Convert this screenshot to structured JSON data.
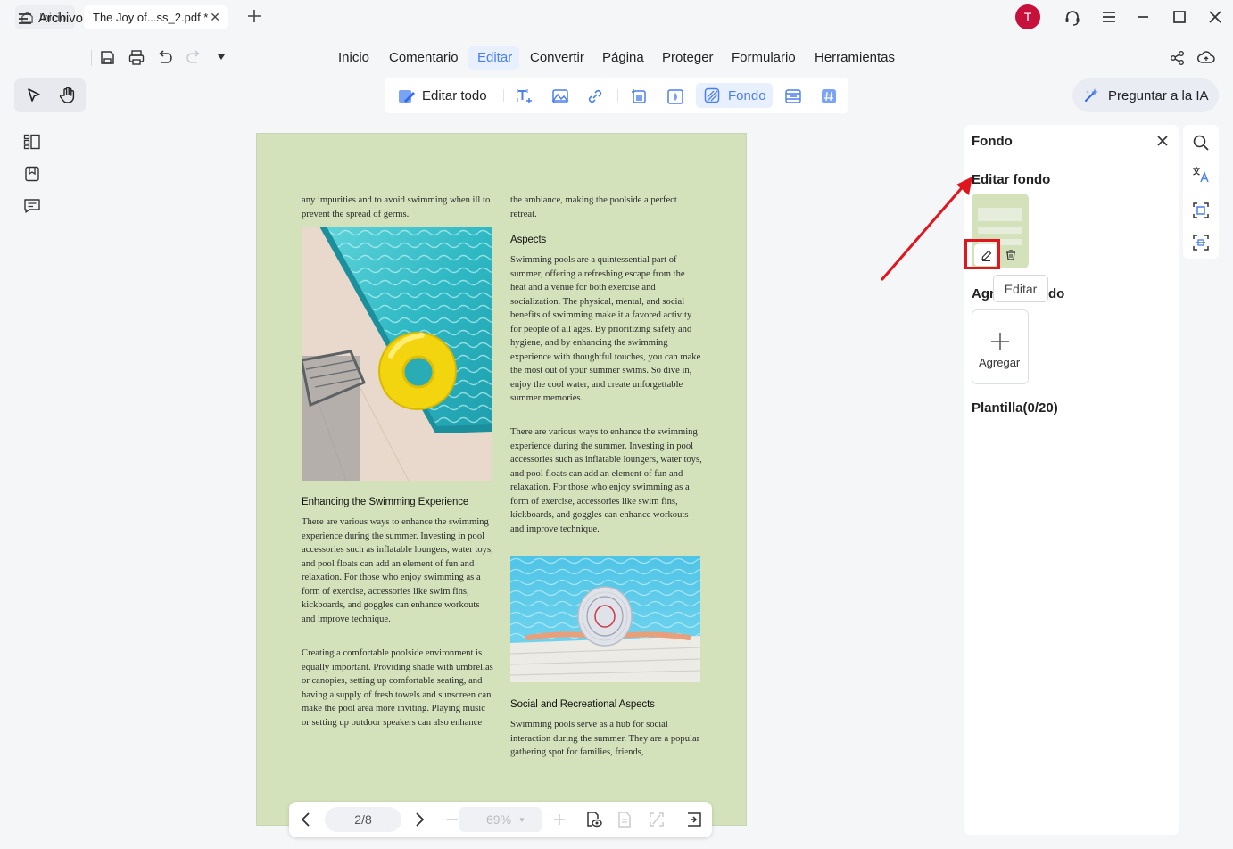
{
  "tabs": {
    "home_label": "Inicio",
    "doc_label": "The Joy of...ss_2.pdf *",
    "close_glyph": "✕",
    "new_tab_icon": "plus-icon"
  },
  "user": {
    "avatar_letter": "T",
    "avatar_color": "#c8103c"
  },
  "menu": {
    "file_label": "Archivo",
    "items": [
      "Inicio",
      "Comentario",
      "Editar",
      "Convertir",
      "Página",
      "Proteger",
      "Formulario",
      "Herramientas"
    ],
    "active": "Editar"
  },
  "toolbar": {
    "edit_all": "Editar todo",
    "background": "Fondo"
  },
  "ai": {
    "label": "Preguntar a la IA"
  },
  "document": {
    "col1_para1": "any impurities and to avoid swimming when ill to prevent the spread of germs.",
    "col1_heading": "Enhancing the Swimming Experience",
    "col1_para2": "There are various ways to enhance the swimming experience during the summer. Investing in pool accessories such as inflatable loungers, water toys, and pool floats can add an element of fun and relaxation. For those who enjoy swimming as a form of exercise, accessories like swim fins, kickboards, and goggles can enhance workouts and improve technique.",
    "col1_para3": "Creating a comfortable poolside environment is equally important. Providing shade with umbrellas or canopies, setting up comfortable seating, and having a supply of fresh towels and sunscreen can make the pool area more inviting. Playing music or setting up outdoor speakers can also enhance",
    "col2_para1": "the ambiance, making the poolside a perfect retreat.",
    "col2_heading1": "Aspects",
    "col2_para2": "Swimming pools are a quintessential part of summer, offering a refreshing escape from the heat and a venue for both exercise and socialization. The physical, mental, and social benefits of swimming make it a favored activity for people of all ages. By prioritizing safety and hygiene, and by enhancing the swimming experience with thoughtful touches, you can make the most out of your summer swims. So dive in, enjoy the cool water, and create unforgettable summer memories.",
    "col2_para3": "There are various ways to enhance the swimming experience during the summer. Investing in pool accessories such as inflatable loungers, water toys, and pool floats can add an element of fun and relaxation. For those who enjoy swimming as a form of exercise, accessories like swim fins, kickboards, and goggles can enhance workouts and improve technique.",
    "col2_heading2": "Social and Recreational Aspects",
    "col2_para4": "Swimming pools serve as a hub for social interaction during the summer. They are a popular gathering spot for families, friends,",
    "page_background": "#d4e2bc"
  },
  "pagenav": {
    "page": "2/8",
    "zoom": "69%"
  },
  "panel": {
    "title": "Fondo",
    "edit_section": "Editar fondo",
    "tooltip": "Editar",
    "add_section_start": "Agr",
    "add_section_end": "do",
    "add_label": "Agregar",
    "template_section": "Plantilla(0/20)",
    "highlight_color": "#e0161e"
  },
  "colors": {
    "accent": "#4a7ff0",
    "annotation": "#e0161e"
  }
}
